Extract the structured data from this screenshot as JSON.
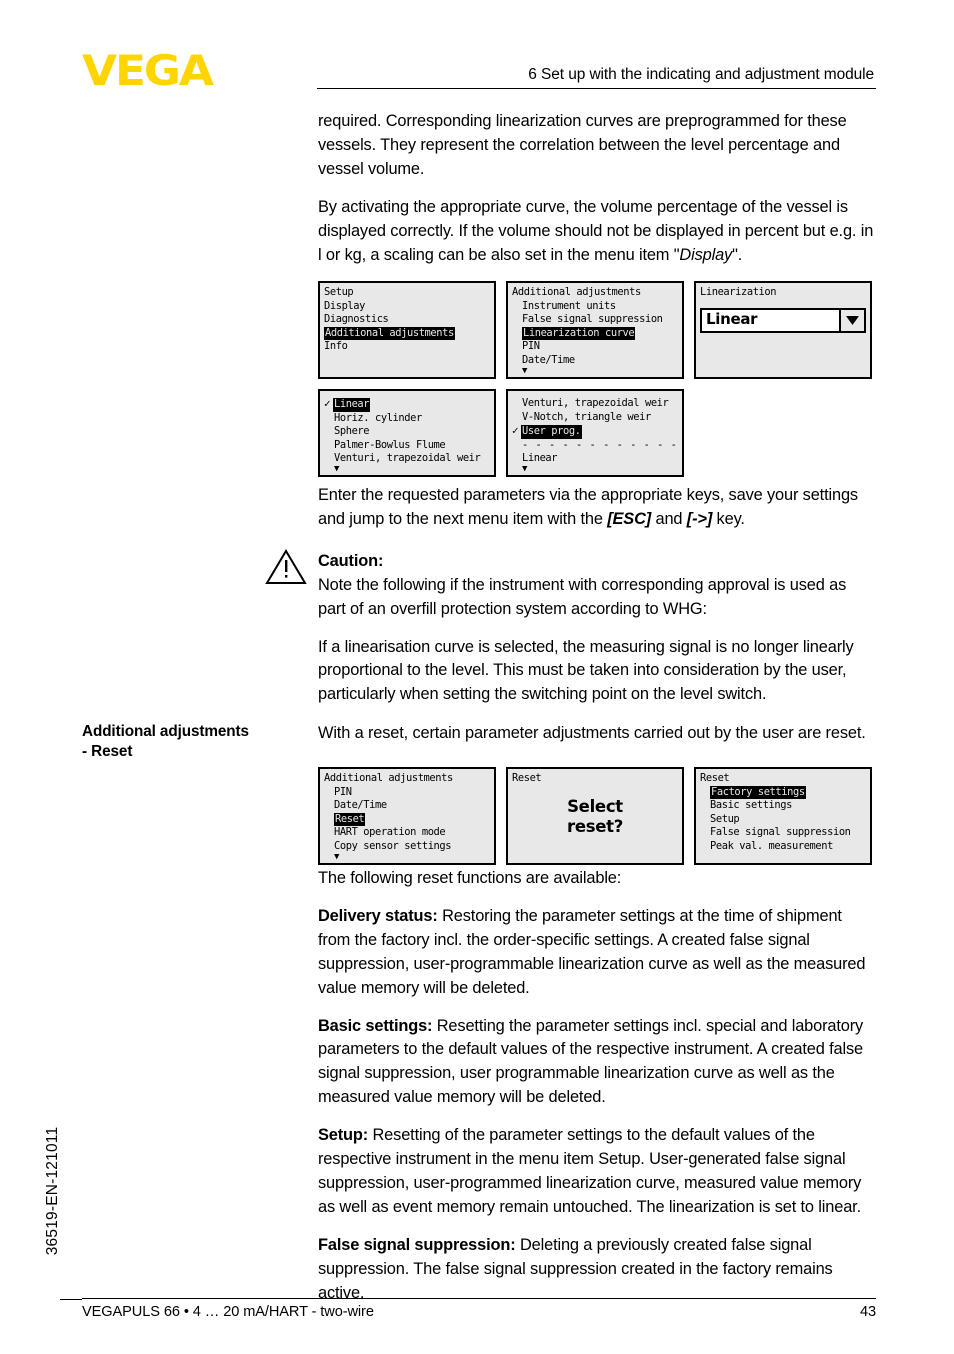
{
  "header": {
    "logo_text": "VEGA",
    "logo_color": "#FFD500",
    "title": "6 Set up with the indicating and adjustment module"
  },
  "body": {
    "para1": "required. Corresponding linearization curves are preprogrammed for these vessels. They represent the correlation between the level percentage and vessel volume.",
    "para2_a": "By activating the appropriate curve, the volume percentage of the vessel is displayed correctly. If the volume should not be displayed in percent but e.g. in l or kg, a scaling can be also set in the menu item \"",
    "para2_italic": "Display",
    "para2_b": "\".",
    "para3_a": "Enter the requested parameters via the appropriate keys, save your settings and jump to the next menu item with the ",
    "para3_key1": "[ESC]",
    "para3_mid": " and ",
    "para3_key2": "[->]",
    "para3_b": " key.",
    "caution_heading": "Caution:",
    "caution_text": "Note the following if the instrument with corresponding approval is used as part of an overfill protection system according to WHG:",
    "caution_para2": "If a linearisation curve is selected, the measuring signal is no longer linearly proportional to the level. This must be taken into consideration by the user, particularly when setting the switching point on the level switch.",
    "reset_intro": "With a reset, certain parameter adjustments carried out by the user are reset.",
    "reset_functions_intro": "The following reset functions are available:",
    "delivery_label": "Delivery status:",
    "delivery_text": " Restoring the parameter settings at the time of shipment from the factory incl. the order-specific settings. A created false signal suppression, user-programmable linearization curve as well as the measured value memory will be deleted.",
    "basic_label": "Basic settings:",
    "basic_text": " Resetting the parameter settings incl. special and laboratory parameters to the default values of the respective instrument. A created false signal suppression, user programmable linearization curve as well as the measured value memory will be deleted.",
    "setup_label": "Setup:",
    "setup_text": " Resetting of the parameter settings to the default values of the respective instrument in the menu item Setup. User-generated false signal suppression, user-programmed linearization curve, measured value memory as well as event memory remain untouched. The linearization is set to linear.",
    "fss_label": "False signal suppression:",
    "fss_text": " Deleting a previously created false signal suppression. The false signal suppression created in the factory remains active."
  },
  "margin_note": {
    "line1": "Additional adjustments",
    "line2": "- Reset"
  },
  "caution_icon_name": "warning-triangle-icon",
  "lcd_screens": {
    "row1": [
      {
        "name": "main-menu-screen",
        "title": null,
        "items": [
          {
            "label": "Setup",
            "highlighted": false,
            "checked": false
          },
          {
            "label": "Display",
            "highlighted": false,
            "checked": false
          },
          {
            "label": "Diagnostics",
            "highlighted": false,
            "checked": false
          },
          {
            "label": "Additional adjustments",
            "highlighted": true,
            "checked": false
          },
          {
            "label": "Info",
            "highlighted": false,
            "checked": false
          }
        ],
        "scroll_arrow": false
      },
      {
        "name": "additional-adjustments-screen",
        "title": "Additional adjustments",
        "items": [
          {
            "label": "Instrument units",
            "highlighted": false,
            "checked": false
          },
          {
            "label": "False signal suppression",
            "highlighted": false,
            "checked": false
          },
          {
            "label": "Linearization curve",
            "highlighted": true,
            "checked": false
          },
          {
            "label": "PIN",
            "highlighted": false,
            "checked": false
          },
          {
            "label": "Date/Time",
            "highlighted": false,
            "checked": false
          }
        ],
        "scroll_arrow": true
      }
    ],
    "dropdown_screen": {
      "name": "linearization-dropdown-screen",
      "title": "Linearization",
      "value": "Linear"
    },
    "row2": [
      {
        "name": "linearization-curve-list-screen",
        "title": null,
        "items": [
          {
            "label": "Linear",
            "highlighted": true,
            "checked": true
          },
          {
            "label": "Horiz. cylinder",
            "highlighted": false,
            "checked": false
          },
          {
            "label": "Sphere",
            "highlighted": false,
            "checked": false
          },
          {
            "label": "Palmer-Bowlus Flume",
            "highlighted": false,
            "checked": false
          },
          {
            "label": "Venturi, trapezoidal weir",
            "highlighted": false,
            "checked": false
          }
        ],
        "scroll_arrow": true
      },
      {
        "name": "linearization-curve-list-screen-2",
        "title": null,
        "items": [
          {
            "label": "Venturi, trapezoidal weir",
            "highlighted": false,
            "checked": false
          },
          {
            "label": "V-Notch, triangle weir",
            "highlighted": false,
            "checked": false
          },
          {
            "label": "User prog.",
            "highlighted": true,
            "checked": true
          },
          {
            "label": "- - - - - - - - - - - - - - -",
            "separator": true
          },
          {
            "label": "Linear",
            "highlighted": false,
            "checked": false
          }
        ],
        "scroll_arrow": true
      }
    ],
    "row3": [
      {
        "name": "additional-adjustments-reset-screen",
        "title": "Additional adjustments",
        "items": [
          {
            "label": "PIN",
            "highlighted": false,
            "checked": false
          },
          {
            "label": "Date/Time",
            "highlighted": false,
            "checked": false
          },
          {
            "label": "Reset",
            "highlighted": true,
            "checked": false
          },
          {
            "label": "HART operation mode",
            "highlighted": false,
            "checked": false
          },
          {
            "label": "Copy sensor settings",
            "highlighted": false,
            "checked": false
          }
        ],
        "scroll_arrow": true
      },
      {
        "name": "select-reset-screen",
        "title": "Reset",
        "big_line1": "Select",
        "big_line2": "reset?"
      },
      {
        "name": "reset-options-screen",
        "title": "Reset",
        "items": [
          {
            "label": "Factory settings",
            "highlighted": true,
            "checked": false
          },
          {
            "label": "Basic settings",
            "highlighted": false,
            "checked": false
          },
          {
            "label": "Setup",
            "highlighted": false,
            "checked": false
          },
          {
            "label": "False signal suppression",
            "highlighted": false,
            "checked": false
          },
          {
            "label": "Peak val. measurement",
            "highlighted": false,
            "checked": false
          }
        ],
        "scroll_arrow": false
      }
    ]
  },
  "footer": {
    "left": "VEGAPULS 66 • 4 … 20 mA/HART - two-wire",
    "page_number": "43"
  },
  "side_code": "36519-EN-121011"
}
